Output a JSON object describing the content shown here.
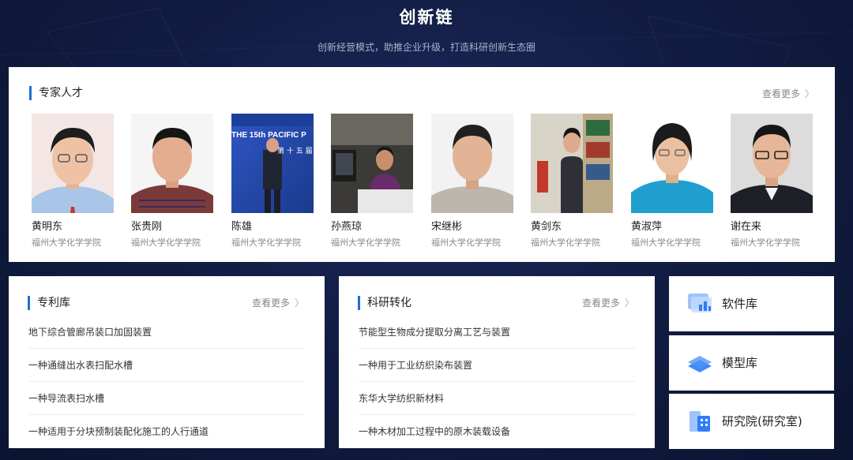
{
  "header": {
    "title": "创新链",
    "subtitle": "创新经营模式，助推企业升级，打造科研创新生态圈"
  },
  "experts": {
    "title": "专家人才",
    "more": "查看更多",
    "items": [
      {
        "name": "黄明东",
        "org": "福州大学化学学院"
      },
      {
        "name": "张贵刚",
        "org": "福州大学化学学院"
      },
      {
        "name": "陈雄",
        "org": "福州大学化学学院",
        "photo_text": "THE 15th PACIFIC P",
        "photo_subtext": "第 十 五 届"
      },
      {
        "name": "孙燕琼",
        "org": "福州大学化学学院"
      },
      {
        "name": "宋继彬",
        "org": "福州大学化学学院"
      },
      {
        "name": "黄剑东",
        "org": "福州大学化学学院"
      },
      {
        "name": "黄淑萍",
        "org": "福州大学化学学院"
      },
      {
        "name": "谢在来",
        "org": "福州大学化学学院"
      }
    ]
  },
  "patents": {
    "title": "专利库",
    "more": "查看更多",
    "items": [
      "地下综合管廊吊装口加固装置",
      "一种通缝出水表扫配水槽",
      "一种导流表扫水槽",
      "一种适用于分块预制装配化施工的人行通道"
    ]
  },
  "research": {
    "title": "科研转化",
    "more": "查看更多",
    "items": [
      "节能型生物成分提取分离工艺与装置",
      "一种用于工业纺织染布装置",
      "东华大学纺织新材料",
      "一种木材加工过程中的原木装载设备"
    ]
  },
  "quick_links": [
    {
      "label": "软件库",
      "icon": "chart-window-icon"
    },
    {
      "label": "模型库",
      "icon": "layers-icon"
    },
    {
      "label": "研究院(研究室)",
      "icon": "building-icon"
    }
  ],
  "colors": {
    "accent": "#1f6fd6",
    "background": "#0f1a3d",
    "icon_blue": "#2f7cf6"
  }
}
